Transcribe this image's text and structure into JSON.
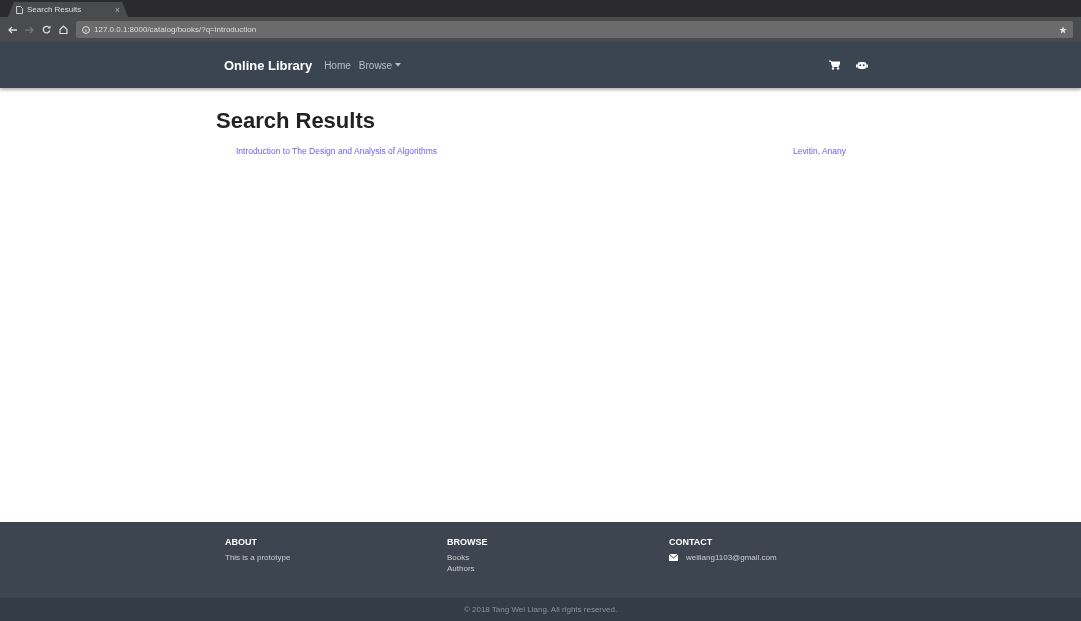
{
  "browser": {
    "tab_title": "Search Results",
    "tab_close": "×",
    "url": "127.0.0.1:8000/catalog/books/?q=introduction"
  },
  "navbar": {
    "brand": "Online Library",
    "links": [
      {
        "label": "Home",
        "dropdown": false
      },
      {
        "label": "Browse",
        "dropdown": true
      }
    ]
  },
  "page": {
    "heading": "Search Results",
    "results": [
      {
        "title": "Introduction to The Design and Analysis of Algorithms",
        "author": "Levitin, Anany"
      }
    ]
  },
  "footer": {
    "columns": [
      {
        "heading": "ABOUT",
        "items": [
          {
            "kind": "text",
            "text": "This is a prototype"
          }
        ]
      },
      {
        "heading": "BROWSE",
        "items": [
          {
            "kind": "link",
            "text": "Books"
          },
          {
            "kind": "link",
            "text": "Authors"
          }
        ]
      },
      {
        "heading": "CONTACT",
        "items": [
          {
            "kind": "email",
            "text": "weiliang1103@gmail.com"
          }
        ]
      }
    ],
    "copyright": "© 2018 Tang Wei Liang. All rights reserved."
  }
}
